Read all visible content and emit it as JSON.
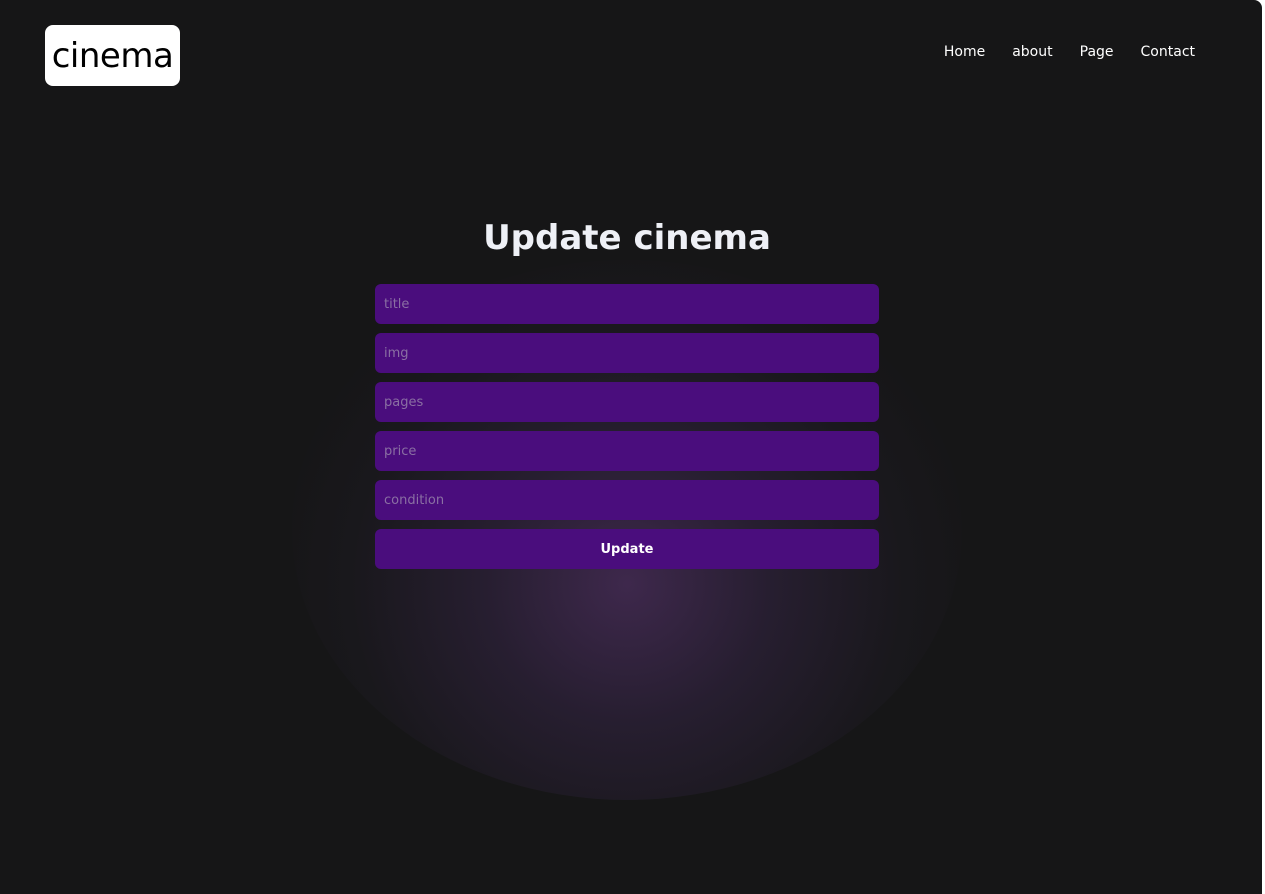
{
  "header": {
    "logo_text": "cinema",
    "nav": [
      {
        "label": "Home"
      },
      {
        "label": "about"
      },
      {
        "label": "Page"
      },
      {
        "label": "Contact"
      }
    ]
  },
  "main": {
    "title": "Update cinema",
    "fields": [
      {
        "name": "title",
        "placeholder": "title",
        "value": ""
      },
      {
        "name": "img",
        "placeholder": "img",
        "value": ""
      },
      {
        "name": "pages",
        "placeholder": "pages",
        "value": ""
      },
      {
        "name": "price",
        "placeholder": "price",
        "value": ""
      },
      {
        "name": "condition",
        "placeholder": "condition",
        "value": ""
      }
    ],
    "submit_label": "Update"
  },
  "colors": {
    "background": "#161617",
    "accent": "#4a0d7d",
    "heading": "#eef0f6",
    "logo_bg": "#ffffff"
  }
}
